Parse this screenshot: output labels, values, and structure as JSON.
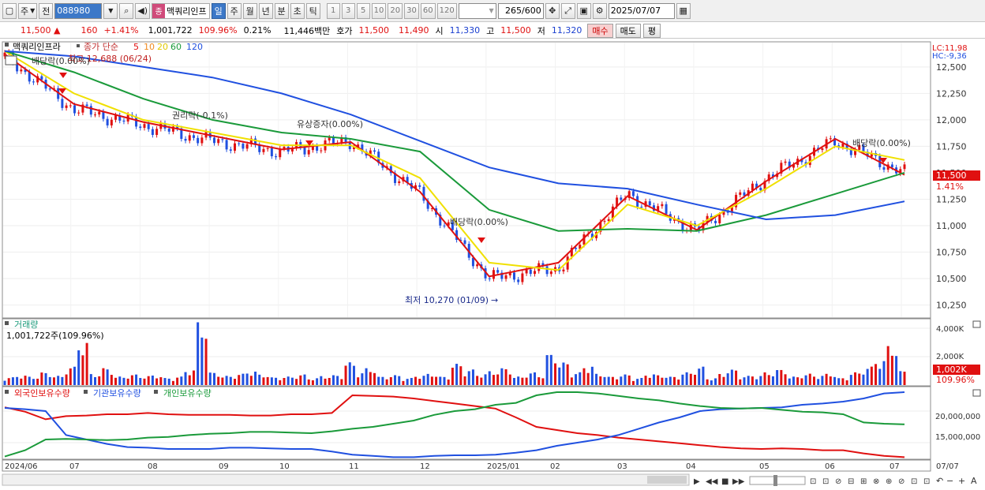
{
  "toolbar": {
    "type_selector": "주",
    "prev_label": "전",
    "code": "088980",
    "stock_name": "맥쿼리인프",
    "name_badge": "종",
    "periods": [
      "일",
      "주",
      "월",
      "년",
      "분",
      "초",
      "틱"
    ],
    "active_period": "일",
    "intervals": [
      "1",
      "3",
      "5",
      "10",
      "20",
      "30",
      "60",
      "120"
    ],
    "count": "265",
    "count_total": "/600",
    "date": "2025/07/07"
  },
  "quote": {
    "price": "11,500",
    "change_arrow": "▲",
    "change": "160",
    "change_pct": "+1.41%",
    "volume": "1,001,722",
    "volume_ratio": "109.96%",
    "turnover": "0.21%",
    "amount": "11,446백만",
    "bid_label": "호가",
    "ask": "11,500",
    "bid": "11,490",
    "open_label": "시",
    "open": "11,330",
    "high_label": "고",
    "high": "11,500",
    "low_label": "저",
    "low": "11,320",
    "buy_button": "매수",
    "sell_button": "매도",
    "extra_button": "평"
  },
  "legend": {
    "name": "맥쿼리인프라",
    "price_label": "종가 단순",
    "ma_labels": [
      "5",
      "10",
      "20",
      "60",
      "120"
    ],
    "ma_colors": [
      "#e01010",
      "#f08a20",
      "#f0e000",
      "#1a9a3a",
      "#2050e0"
    ],
    "high_note": "최고 12,688 (06/24)",
    "low_note": "최저 10,270 (01/09)",
    "lc": "LC:11,98",
    "hc": "HC:-9,36",
    "last_price": "11,500",
    "last_pct": "1.41%"
  },
  "annotations": {
    "dividend_1": "배당락(0.00%)",
    "rights_1": "권리락(-0.1%)",
    "paid_in": "유상증자(0.00%)",
    "dividend_2": "배당락(0.00%)",
    "dividend_3": "배당락(0.00%)"
  },
  "volume_panel": {
    "title": "거래량",
    "current": "1,001,722주(109.96%)",
    "last_label": "1,002K",
    "last_pct": "109.96%"
  },
  "holdings_panel": {
    "titles": [
      "외국인보유수량",
      "기관보유수량",
      "개인보유수량"
    ],
    "colors": [
      "#e01010",
      "#2050e0",
      "#1a9a3a"
    ]
  },
  "x_axis_labels": [
    "2024/06",
    "07",
    "08",
    "09",
    "10",
    "11",
    "12",
    "2025/01",
    "02",
    "03",
    "04",
    "05",
    "06",
    "07",
    "07/07"
  ],
  "chart_data": [
    {
      "type": "line",
      "title": "",
      "series_name": "맥쿼리인프라 종가",
      "x": [
        "2024/06",
        "07",
        "08",
        "09",
        "10",
        "11",
        "12",
        "2025/01",
        "02",
        "03",
        "04",
        "05",
        "06",
        "07"
      ],
      "series": [
        {
          "name": "종가",
          "values": [
            12600,
            12100,
            11950,
            11800,
            11700,
            11800,
            11300,
            10500,
            10600,
            11300,
            10950,
            11450,
            11800,
            11500
          ]
        },
        {
          "name": "5",
          "values": [
            12620,
            12150,
            11980,
            11850,
            11720,
            11790,
            11320,
            10520,
            10650,
            11280,
            10960,
            11420,
            11820,
            11480
          ]
        },
        {
          "name": "20",
          "values": [
            12650,
            12250,
            12000,
            11880,
            11760,
            11760,
            11450,
            10650,
            10580,
            11200,
            11000,
            11350,
            11750,
            11620
          ]
        },
        {
          "name": "60",
          "values": [
            12650,
            12450,
            12200,
            12000,
            11880,
            11820,
            11700,
            11150,
            10950,
            10970,
            10950,
            11100,
            11300,
            11500
          ]
        },
        {
          "name": "120",
          "values": [
            12650,
            12600,
            12500,
            12400,
            12250,
            12050,
            11800,
            11550,
            11400,
            11350,
            11200,
            11060,
            11100,
            11230
          ]
        }
      ],
      "ylim": [
        10150,
        12700
      ],
      "yticks": [
        10250,
        10500,
        10750,
        11000,
        11250,
        11500,
        11750,
        12000,
        12250,
        12500
      ]
    },
    {
      "type": "bar",
      "title": "거래량",
      "ylabels": [
        "4,000K",
        "2,000K"
      ],
      "ylim": [
        0,
        4500
      ],
      "values_k": [
        550,
        700,
        600,
        900,
        650,
        1300,
        3100,
        800,
        1200,
        600,
        750,
        650,
        700,
        500,
        600,
        1100,
        4500,
        900,
        650,
        800,
        1000,
        750,
        550,
        600,
        750,
        500,
        650,
        700,
        1600,
        900,
        1200,
        600,
        700,
        500,
        700,
        800,
        600,
        1500,
        1100,
        800,
        1000,
        1200,
        600,
        900,
        700,
        2200,
        1600,
        900,
        1400,
        800,
        600,
        750,
        500,
        800,
        700,
        600,
        900,
        1300,
        500,
        800,
        1100,
        650,
        700,
        900,
        1100,
        600,
        800,
        700,
        800,
        500,
        900,
        1300,
        1800,
        2800,
        1002
      ],
      "colors": [
        "red",
        "blue"
      ]
    },
    {
      "type": "line",
      "title": "보유수량",
      "ylabels": [
        "20,000,000",
        "15,000,000"
      ],
      "ylim": [
        12500000,
        23500000
      ],
      "series": [
        {
          "name": "외국인보유수량",
          "values": [
            20600000,
            19900000,
            18700000,
            19200000,
            19300000,
            19500000,
            19500000,
            19700000,
            19500000,
            19400000,
            19400000,
            19400000,
            19300000,
            19300000,
            19500000,
            19500000,
            19700000,
            22500000,
            22400000,
            22300000,
            22000000,
            21600000,
            21200000,
            20800000,
            20400000,
            19000000,
            17500000,
            17000000,
            16500000,
            16200000,
            15800000,
            15500000,
            15200000,
            14900000,
            14600000,
            14300000,
            14100000,
            14000000,
            14100000,
            14000000,
            13800000,
            13800000,
            13300000,
            12900000,
            12700000
          ]
        },
        {
          "name": "기관보유수량",
          "values": [
            20500000,
            20300000,
            20000000,
            16200000,
            15500000,
            14800000,
            14300000,
            14200000,
            14000000,
            14000000,
            14000000,
            14200000,
            14200000,
            14100000,
            14000000,
            14000000,
            13600000,
            13100000,
            12900000,
            12700000,
            12700000,
            12900000,
            13000000,
            13000000,
            13100000,
            13400000,
            13800000,
            14500000,
            15000000,
            15500000,
            16200000,
            17200000,
            18200000,
            19000000,
            20000000,
            20300000,
            20400000,
            20500000,
            20600000,
            21000000,
            21200000,
            21500000,
            22000000,
            22800000,
            23000000
          ]
        },
        {
          "name": "개인보유수량",
          "values": [
            12800000,
            13800000,
            15500000,
            15600000,
            15500000,
            15400000,
            15500000,
            15800000,
            15900000,
            16200000,
            16400000,
            16500000,
            16700000,
            16700000,
            16600000,
            16500000,
            16800000,
            17200000,
            17500000,
            18000000,
            18500000,
            19400000,
            20000000,
            20300000,
            21000000,
            21300000,
            22500000,
            23000000,
            23000000,
            22800000,
            22400000,
            22000000,
            21700000,
            21200000,
            20800000,
            20500000,
            20400000,
            20500000,
            20200000,
            19900000,
            19800000,
            19500000,
            18200000,
            18000000,
            17900000
          ]
        }
      ]
    }
  ]
}
